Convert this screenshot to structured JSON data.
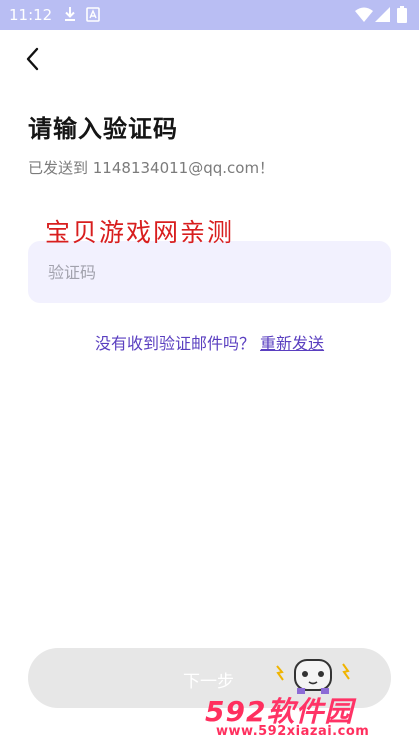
{
  "status_bar": {
    "time": "11:12",
    "icons": [
      "download-icon",
      "notification-a-icon",
      "wifi-icon",
      "signal-icon",
      "battery-icon"
    ]
  },
  "header": {
    "back_icon": "chevron-left-icon"
  },
  "page": {
    "title": "请输入验证码",
    "subtitle": "已发送到 1148134011@qq.com！"
  },
  "watermark": {
    "text": "宝贝游戏网亲测"
  },
  "form": {
    "code_placeholder": "验证码",
    "code_value": ""
  },
  "resend": {
    "question": "没有收到验证邮件吗？",
    "link": "重新发送"
  },
  "next_button": {
    "label": "下一步"
  },
  "site_logo": {
    "number": "592",
    "name": "软件园",
    "url": "www.592xiazai.com"
  },
  "colors": {
    "status_bar": "#b9bef3",
    "input_bg": "#f2f1fe",
    "link": "#5a3fc0",
    "button_bg": "#e7e7e7",
    "watermark": "#d81e1e",
    "logo": "#ff2f5e"
  }
}
